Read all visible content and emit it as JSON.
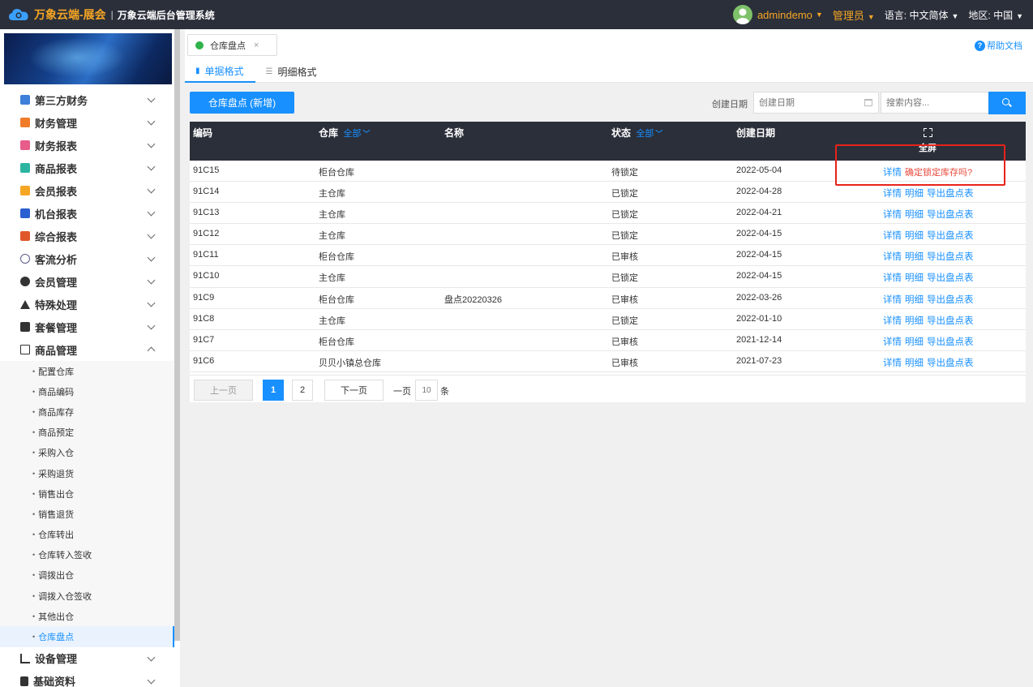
{
  "app": {
    "title": "万象云端-展会",
    "separator": "|",
    "subtitle": "万象云端后台管理系统"
  },
  "topbar": {
    "user": "admindemo",
    "role": "管理员",
    "language_label": "语言:",
    "language_value": "中文简体",
    "region_label": "地区:",
    "region_value": "中国"
  },
  "sidebar": {
    "items": [
      {
        "label": "第三方财务",
        "icon": "calculator-icon",
        "color": "#3d7fd9"
      },
      {
        "label": "财务管理",
        "icon": "ledger-icon",
        "color": "#f07c2a"
      },
      {
        "label": "财务报表",
        "icon": "report-icon",
        "color": "#e85c8a"
      },
      {
        "label": "商品报表",
        "icon": "goods-report-icon",
        "color": "#2bb5a0"
      },
      {
        "label": "会员报表",
        "icon": "member-report-icon",
        "color": "#f5a623"
      },
      {
        "label": "机台报表",
        "icon": "machine-report-icon",
        "color": "#2a5fd1"
      },
      {
        "label": "综合报表",
        "icon": "layers-icon",
        "color": "#e0572c"
      },
      {
        "label": "客流分析",
        "icon": "traffic-icon",
        "color": "#5a5a8c"
      },
      {
        "label": "会员管理",
        "icon": "user-icon",
        "color": "#333333"
      },
      {
        "label": "特殊处理",
        "icon": "warning-icon",
        "color": "#333333"
      },
      {
        "label": "套餐管理",
        "icon": "package-icon",
        "color": "#333333"
      },
      {
        "label": "商品管理",
        "icon": "swap-icon",
        "color": "#333333"
      }
    ],
    "submenu": [
      "配置仓库",
      "商品编码",
      "商品库存",
      "商品预定",
      "采购入仓",
      "采购退货",
      "销售出仓",
      "销售退货",
      "仓库转出",
      "仓库转入签收",
      "调拨出仓",
      "调拨入仓签收",
      "其他出仓",
      "仓库盘点"
    ],
    "active_sub": "仓库盘点",
    "bottom_items": [
      {
        "label": "设备管理",
        "icon": "device-icon"
      },
      {
        "label": "基础资料",
        "icon": "file-icon"
      }
    ]
  },
  "page_tab": {
    "label": "仓库盘点",
    "close": "×"
  },
  "help": {
    "label": "帮助文档"
  },
  "view_tabs": [
    {
      "label": "单据格式",
      "active": true
    },
    {
      "label": "明细格式",
      "active": false
    }
  ],
  "toolbar": {
    "add_label": "仓库盘点 (新增)",
    "date_label": "创建日期",
    "date_placeholder": "创建日期",
    "search_placeholder": "搜索内容..."
  },
  "table": {
    "headers": {
      "code": "编码",
      "warehouse": "仓库",
      "warehouse_filter": "全部",
      "name": "名称",
      "status": "状态",
      "status_filter": "全部",
      "date": "创建日期",
      "fullscreen": "全屏"
    },
    "rows": [
      {
        "code": "91C15",
        "warehouse": "柜台仓库",
        "name": "",
        "status": "待锁定",
        "date": "2022-05-04",
        "actions": [
          "详情"
        ],
        "confirm": "确定锁定库存吗?"
      },
      {
        "code": "91C14",
        "warehouse": "主仓库",
        "name": "",
        "status": "已锁定",
        "date": "2022-04-28",
        "actions": [
          "详情",
          "明细",
          "导出盘点表"
        ],
        "confirm": ""
      },
      {
        "code": "91C13",
        "warehouse": "主仓库",
        "name": "",
        "status": "已锁定",
        "date": "2022-04-21",
        "actions": [
          "详情",
          "明细",
          "导出盘点表"
        ],
        "confirm": ""
      },
      {
        "code": "91C12",
        "warehouse": "主仓库",
        "name": "",
        "status": "已锁定",
        "date": "2022-04-15",
        "actions": [
          "详情",
          "明细",
          "导出盘点表"
        ],
        "confirm": ""
      },
      {
        "code": "91C11",
        "warehouse": "柜台仓库",
        "name": "",
        "status": "已审核",
        "date": "2022-04-15",
        "actions": [
          "详情",
          "明细",
          "导出盘点表"
        ],
        "confirm": ""
      },
      {
        "code": "91C10",
        "warehouse": "主仓库",
        "name": "",
        "status": "已锁定",
        "date": "2022-04-15",
        "actions": [
          "详情",
          "明细",
          "导出盘点表"
        ],
        "confirm": ""
      },
      {
        "code": "91C9",
        "warehouse": "柜台仓库",
        "name": "盘点20220326",
        "status": "已审核",
        "date": "2022-03-26",
        "actions": [
          "详情",
          "明细",
          "导出盘点表"
        ],
        "confirm": ""
      },
      {
        "code": "91C8",
        "warehouse": "主仓库",
        "name": "",
        "status": "已锁定",
        "date": "2022-01-10",
        "actions": [
          "详情",
          "明细",
          "导出盘点表"
        ],
        "confirm": ""
      },
      {
        "code": "91C7",
        "warehouse": "柜台仓库",
        "name": "",
        "status": "已审核",
        "date": "2021-12-14",
        "actions": [
          "详情",
          "明细",
          "导出盘点表"
        ],
        "confirm": ""
      },
      {
        "code": "91C6",
        "warehouse": "贝贝小镇总仓库",
        "name": "",
        "status": "已审核",
        "date": "2021-07-23",
        "actions": [
          "详情",
          "明细",
          "导出盘点表"
        ],
        "confirm": ""
      }
    ]
  },
  "pagination": {
    "prev": "上一页",
    "pages": [
      "1",
      "2"
    ],
    "current": "1",
    "next": "下一页",
    "per_page_label": "一页",
    "per_page_placeholder": "10",
    "per_page_unit": "条"
  },
  "colors": {
    "accent": "#1890ff",
    "topbar_bg": "#2b2f3a",
    "brand": "#f5a623",
    "danger": "#e8483b",
    "highlight_box": "#e8231a"
  }
}
